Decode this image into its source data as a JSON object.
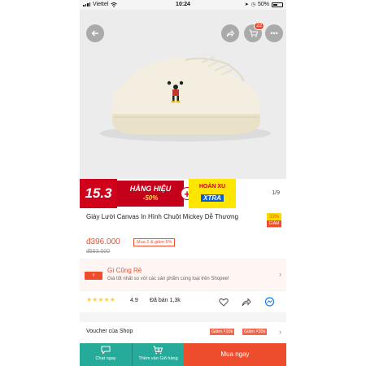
{
  "status_bar": {
    "carrier": "Viettel",
    "time": "10:24",
    "battery": "50%"
  },
  "header": {
    "cart_count": "22"
  },
  "banner": {
    "date": "15.3",
    "line1": "HÀNG HIỆU",
    "line2": "-50%",
    "plus": "+",
    "right_line1": "HOÀN XU",
    "right_line2": "XTRA",
    "page_indicator": "1/9"
  },
  "product": {
    "title": "Giày Lười Canvas In Hình Chuột Mickey Dễ Thương",
    "discount_badge": "33%",
    "discount_badge_sub": "GIẢM",
    "price": "đ396.000",
    "promo_tag": "Mua 2 & giảm 5%",
    "old_price": "đ593.000"
  },
  "cheap_guarantee": {
    "title": "Gì Cũng Rẻ",
    "subtitle": "Giá tốt nhất so với các sản phẩm cùng loại trên Shopee!"
  },
  "rating": {
    "stars": "★★★★★",
    "value": "4.9",
    "value_numeric": 4.9,
    "sold": "Đã bán 1,3k"
  },
  "voucher": {
    "label": "Voucher của Shop",
    "tag1": "Giảm ₫10k",
    "tag2": "Giảm ₫35k"
  },
  "bottom_bar": {
    "chat": "Chat ngay",
    "add_cart": "Thêm vào Giỏ hàng",
    "buy": "Mua ngay"
  },
  "colors": {
    "shopee_orange": "#ee4d2d",
    "teal": "#26aa99",
    "red_banner": "#d0011b",
    "yellow": "#ffe600"
  }
}
